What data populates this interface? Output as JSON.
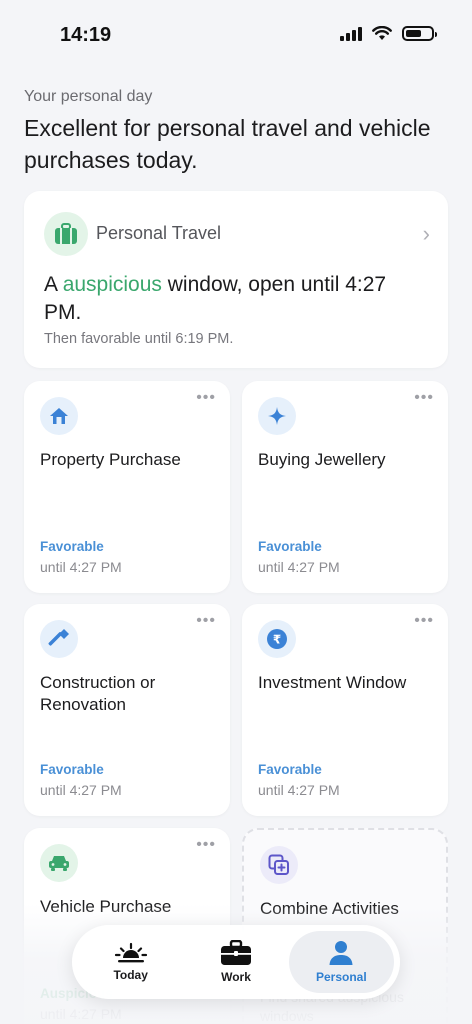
{
  "status_bar": {
    "time": "14:19"
  },
  "header": {
    "subtitle": "Your personal day",
    "title": "Excellent for personal travel and vehicle purchases today."
  },
  "featured": {
    "name": "Personal Travel",
    "line_prefix": "A ",
    "line_highlight": "auspicious",
    "line_suffix": " window, open until 4:27 PM.",
    "then": "Then favorable until 6:19 PM.",
    "icon": "briefcase-icon"
  },
  "cards": [
    {
      "title": "Property Purchase",
      "status": "Favorable",
      "until": "until 4:27 PM",
      "icon": "house-icon"
    },
    {
      "title": "Buying Jewellery",
      "status": "Favorable",
      "until": "until 4:27 PM",
      "icon": "sparkle-icon"
    },
    {
      "title": "Construction or Renovation",
      "status": "Favorable",
      "until": "until 4:27 PM",
      "icon": "hammer-icon"
    },
    {
      "title": "Investment Window",
      "status": "Favorable",
      "until": "until 4:27 PM",
      "icon": "rupee-icon"
    },
    {
      "title": "Vehicle Purchase",
      "status": "Auspicious",
      "until": "until 4:27 PM",
      "icon": "car-icon"
    },
    {
      "title": "Combine Activities",
      "subtitle": "Find shared auspicious windows",
      "icon": "combine-icon"
    }
  ],
  "colors": {
    "favorable": "#4a90d6",
    "auspicious": "#3aa76d",
    "active_tab": "#2f7fd0"
  },
  "nav": {
    "items": [
      {
        "label": "Today",
        "icon": "sunrise-icon"
      },
      {
        "label": "Work",
        "icon": "briefcase-icon"
      },
      {
        "label": "Personal",
        "icon": "person-icon"
      }
    ],
    "active": "Personal"
  }
}
